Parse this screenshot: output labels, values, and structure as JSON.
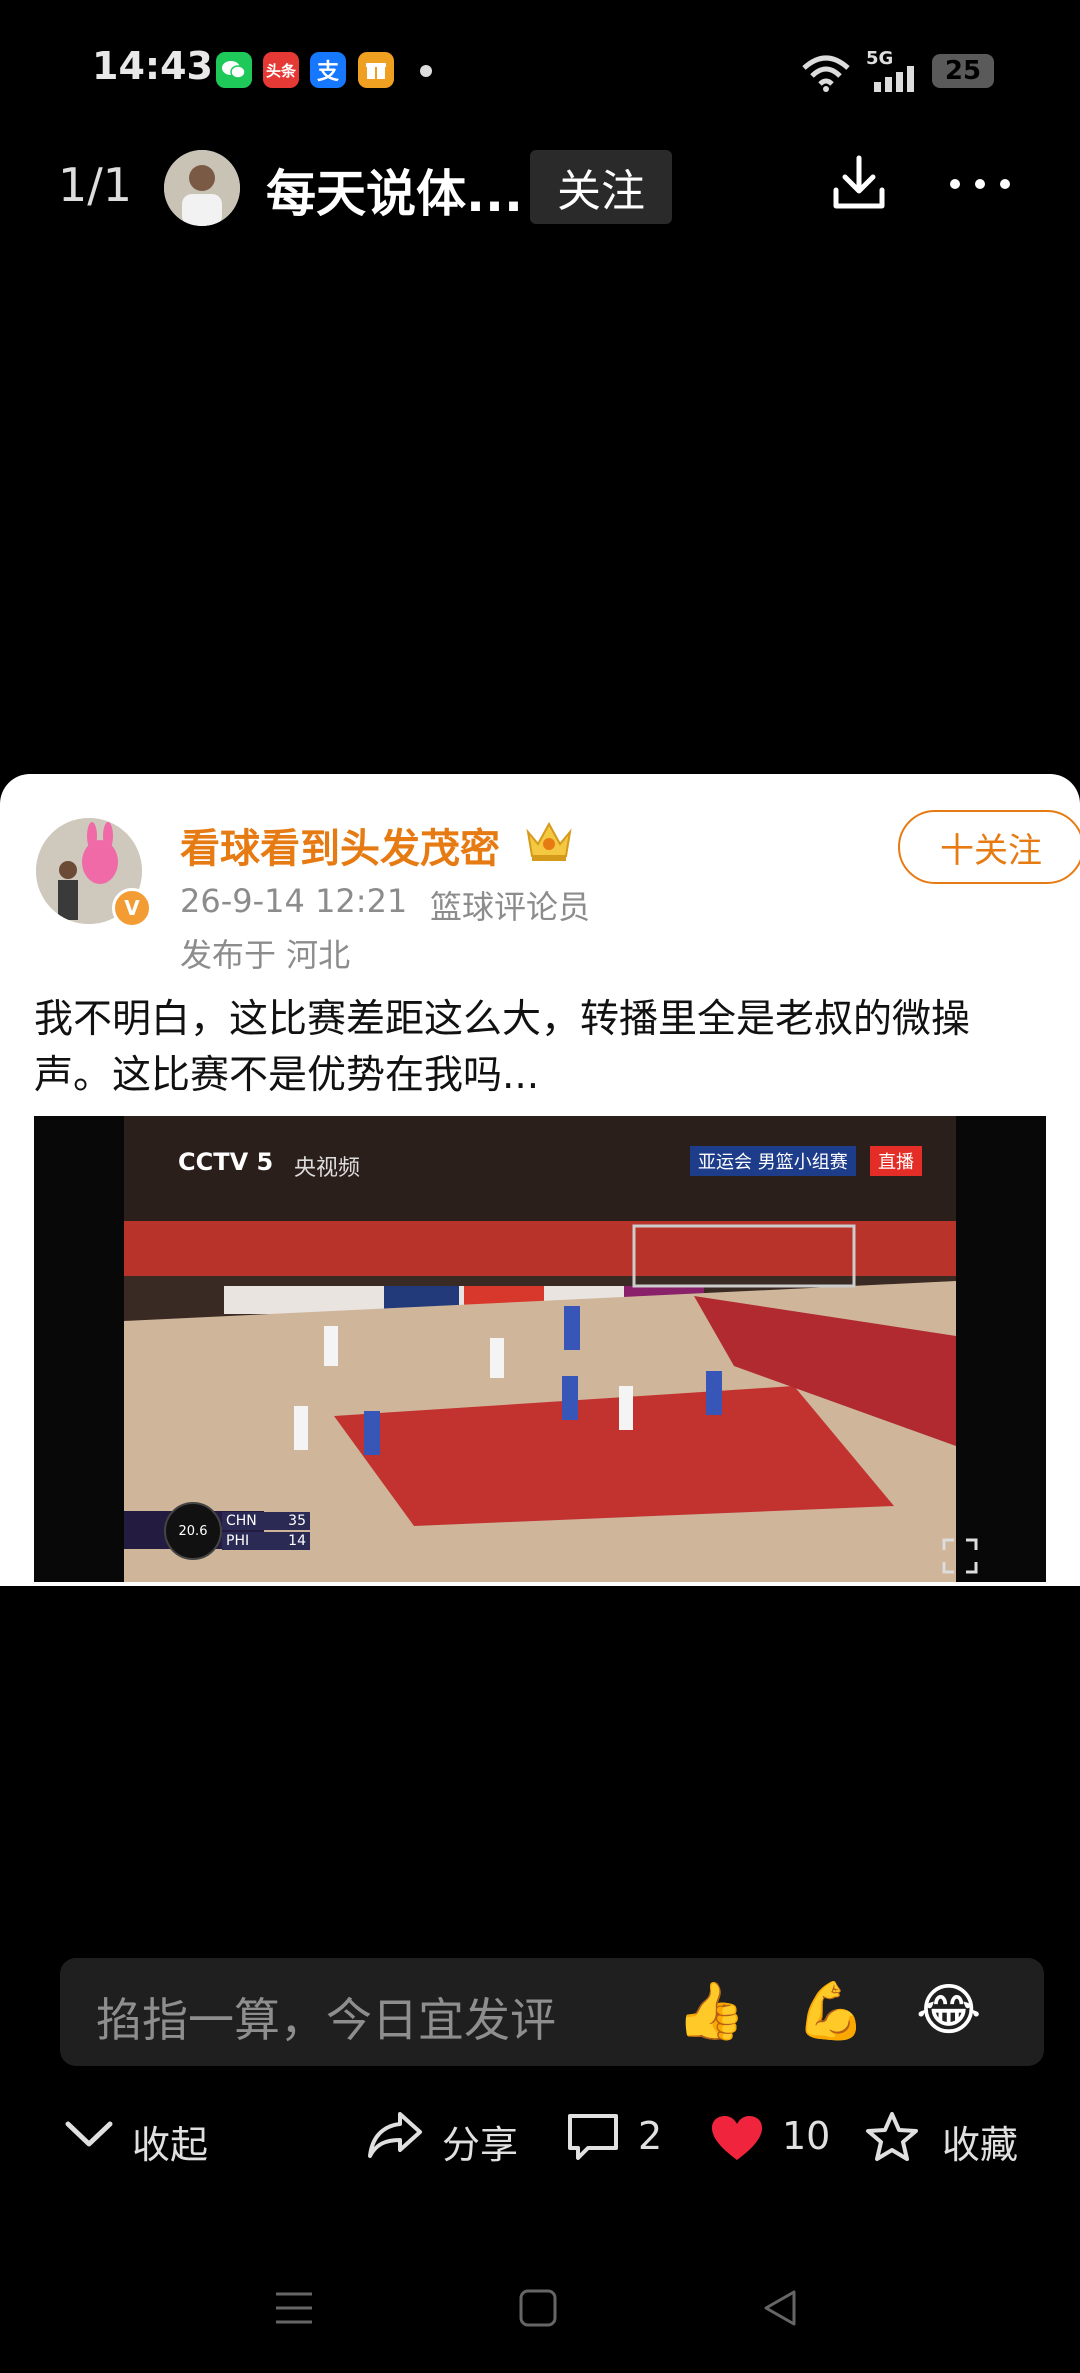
{
  "status_bar": {
    "time": "14:43",
    "network": "5G",
    "battery": "25",
    "app_icons": [
      {
        "name": "wechat-icon",
        "glyph": "",
        "color": "#1ec95a"
      },
      {
        "name": "toutiao-icon",
        "glyph": "头条",
        "color": "#e53935"
      },
      {
        "name": "alipay-icon",
        "glyph": "支",
        "color": "#1677ff"
      },
      {
        "name": "gift-app-icon",
        "glyph": "",
        "color": "#f0a020"
      }
    ]
  },
  "header": {
    "page_counter": "1/1",
    "author_name": "每天说体...",
    "follow_label": "关注"
  },
  "post": {
    "author": "看球看到头发茂密",
    "date": "26-9-14 12:21",
    "role": "篮球评论员",
    "location": "发布于 河北",
    "follow_label": "十关注",
    "text": "我不明白，这比赛差距这么大，转播里全是老叔的微操声。这比赛不是优势在我吗...",
    "video": {
      "channel": "CCTV 5",
      "sub_logo": "央视频",
      "event": "亚运会 男篮小组赛",
      "live": "直播",
      "clock": "20.6",
      "team1": "CHN",
      "score1": "35",
      "team2": "PHI",
      "score2": "14"
    }
  },
  "comment_bar": {
    "placeholder": "掐指一算，今日宜发评",
    "emojis": [
      "👍",
      "💪",
      "😂"
    ]
  },
  "actions": {
    "collapse": "收起",
    "share": "分享",
    "comments": "2",
    "likes": "10",
    "favorite": "收藏"
  },
  "colors": {
    "accent": "#e77b13",
    "like": "#f0253d"
  }
}
